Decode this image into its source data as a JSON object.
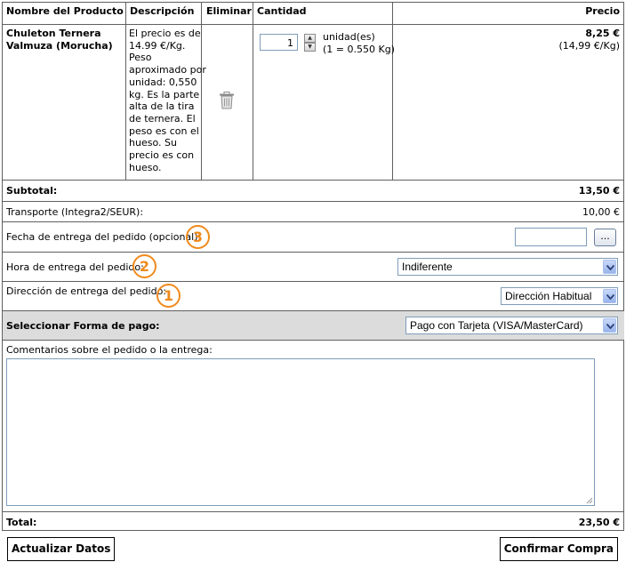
{
  "table": {
    "headers": {
      "product": "Nombre del Producto",
      "description": "Descripción",
      "delete": "Eliminar",
      "quantity": "Cantidad",
      "price": "Precio"
    },
    "item": {
      "name_line1": "Chuleton Ternera",
      "name_line2": "Valmuza (Morucha)",
      "description_lines": [
        "El precio es de",
        "14.99 €/Kg.",
        "Peso",
        "aproximado por",
        "unidad: 0,550",
        "kg. Es la parte",
        "alta de la tira",
        "de ternera. El",
        "peso es con el",
        "hueso. Su",
        "precio es con",
        "hueso."
      ],
      "delete_icon": "trash-icon",
      "quantity_value": "1",
      "unit_label": "unidad(es)",
      "unit_equiv": "(1 = 0.550 Kg)",
      "price": "8,25 €",
      "price_per_kg": "(14,99 €/Kg)"
    }
  },
  "summary": {
    "subtotal_label": "Subtotal:",
    "subtotal_value": "13,50 €",
    "shipping_label": "Transporte (Integra2/SEUR):",
    "shipping_value": "10,00 €"
  },
  "delivery": {
    "date_label": "Fecha de entrega del pedido (opcional):",
    "date_value": "",
    "date_button": "...",
    "time_label": "Hora de entrega del pedido:",
    "time_selected": "Indiferente",
    "address_label": "Dirección de entrega del pedido:",
    "address_selected": "Dirección Habitual"
  },
  "payment": {
    "label": "Seleccionar Forma de pago:",
    "selected": "Pago con Tarjeta (VISA/MasterCard)"
  },
  "comments": {
    "label": "Comentarios sobre el pedido o la entrega:",
    "value": ""
  },
  "total": {
    "label": "Total:",
    "value": "23,50 €"
  },
  "annotations": {
    "badge_date": "3",
    "badge_time": "2",
    "badge_address": "1",
    "badge_color": "#f08a1c"
  },
  "buttons": {
    "update": "Actualizar Datos",
    "confirm": "Confirmar Compra"
  }
}
